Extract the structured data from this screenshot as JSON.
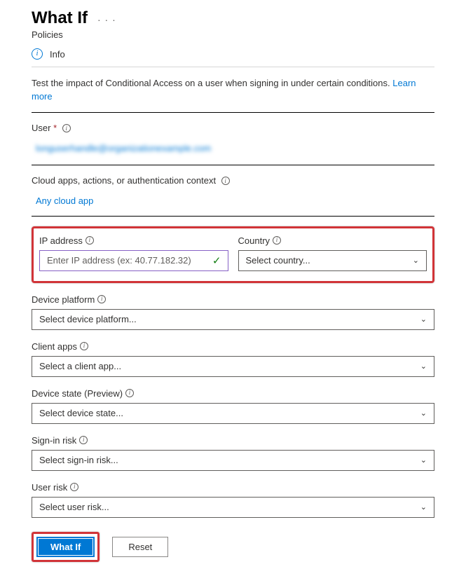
{
  "header": {
    "title": "What If",
    "subtitle": "Policies",
    "info_label": "Info"
  },
  "description": {
    "text": "Test the impact of Conditional Access on a user when signing in under certain conditions.",
    "learn_more": "Learn more"
  },
  "user": {
    "label": "User",
    "value": "longuserhandle@organizationexample.com"
  },
  "cloud": {
    "label": "Cloud apps, actions, or authentication context",
    "link": "Any cloud app"
  },
  "ip": {
    "label": "IP address",
    "placeholder": "Enter IP address (ex: 40.77.182.32)"
  },
  "country": {
    "label": "Country",
    "placeholder": "Select country..."
  },
  "device_platform": {
    "label": "Device platform",
    "placeholder": "Select device platform..."
  },
  "client_apps": {
    "label": "Client apps",
    "placeholder": "Select a client app..."
  },
  "device_state": {
    "label": "Device state (Preview)",
    "placeholder": "Select device state..."
  },
  "signin_risk": {
    "label": "Sign-in risk",
    "placeholder": "Select sign-in risk..."
  },
  "user_risk": {
    "label": "User risk",
    "placeholder": "Select user risk..."
  },
  "buttons": {
    "whatif": "What If",
    "reset": "Reset"
  }
}
